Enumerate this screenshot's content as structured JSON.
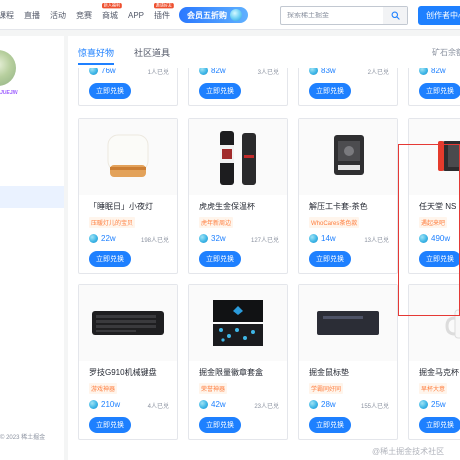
{
  "nav": {
    "items": [
      {
        "label": "课程",
        "badge": ""
      },
      {
        "label": "直播",
        "badge": ""
      },
      {
        "label": "活动",
        "badge": ""
      },
      {
        "label": "竞赛",
        "badge": ""
      },
      {
        "label": "商城",
        "badge": "新人福利"
      },
      {
        "label": "APP",
        "badge": ""
      },
      {
        "label": "插件",
        "badge": "邀请好友"
      }
    ],
    "vip_label": "会员五折购",
    "search_placeholder": "探索稀土掘金",
    "creator_label": "创作者中心"
  },
  "sidebar": {
    "badge_text": "JUEJIN",
    "copyright": "© 2023 稀土掘金"
  },
  "tabs": {
    "items": [
      "惊喜好物",
      "社区道具"
    ],
    "right_label": "矿石余额"
  },
  "top_row": [
    {
      "price": "76w",
      "sold": "1人已兑",
      "button": "立即兑换"
    },
    {
      "price": "82w",
      "sold": "3人已兑",
      "button": "立即兑换"
    },
    {
      "price": "83w",
      "sold": "2人已兑",
      "button": "立即兑换"
    },
    {
      "price": "82w",
      "sold": "",
      "button": "立即兑换"
    }
  ],
  "products": [
    {
      "title": "「睡眠日」小夜灯",
      "tag": "压暖灯儿的宝贝",
      "price": "22w",
      "sold": "198人已兑",
      "button": "立即兑换",
      "image_icon": "night-lamp-icon"
    },
    {
      "title": "虎虎生金保温杯",
      "tag": "虎年新周边",
      "price": "32w",
      "sold": "127人已兑",
      "button": "立即兑换",
      "image_icon": "thermos-icon"
    },
    {
      "title": "解压工卡套-茶色",
      "tag": "WhoCares茶色款",
      "price": "14w",
      "sold": "13人已兑",
      "button": "立即兑换",
      "image_icon": "card-holder-icon"
    },
    {
      "title": "任天堂 NS 日",
      "tag": "遇起来吧",
      "price": "490w",
      "sold": "",
      "button": "立即兑换",
      "image_icon": "nintendo-switch-icon"
    },
    {
      "title": "罗技G910机械键盘",
      "tag": "游戏神器",
      "price": "210w",
      "sold": "4人已兑",
      "button": "立即兑换",
      "image_icon": "keyboard-icon"
    },
    {
      "title": "掘金限量徽章套盒",
      "tag": "荣誉神器",
      "price": "42w",
      "sold": "23人已兑",
      "button": "立即兑换",
      "image_icon": "badge-box-icon"
    },
    {
      "title": "掘金鼠标垫",
      "tag": "学霸同好同",
      "price": "28w",
      "sold": "155人已兑",
      "button": "立即兑换",
      "image_icon": "mouse-pad-icon"
    },
    {
      "title": "掘金马克杯",
      "tag": "早杯大意",
      "price": "25w",
      "sold": "",
      "button": "立即兑换",
      "image_icon": "mug-icon"
    }
  ],
  "watermark": "@稀土掘金技术社区",
  "colors": {
    "accent": "#1e80ff",
    "tag": "#ff7d3d",
    "highlight": "#e53935"
  }
}
